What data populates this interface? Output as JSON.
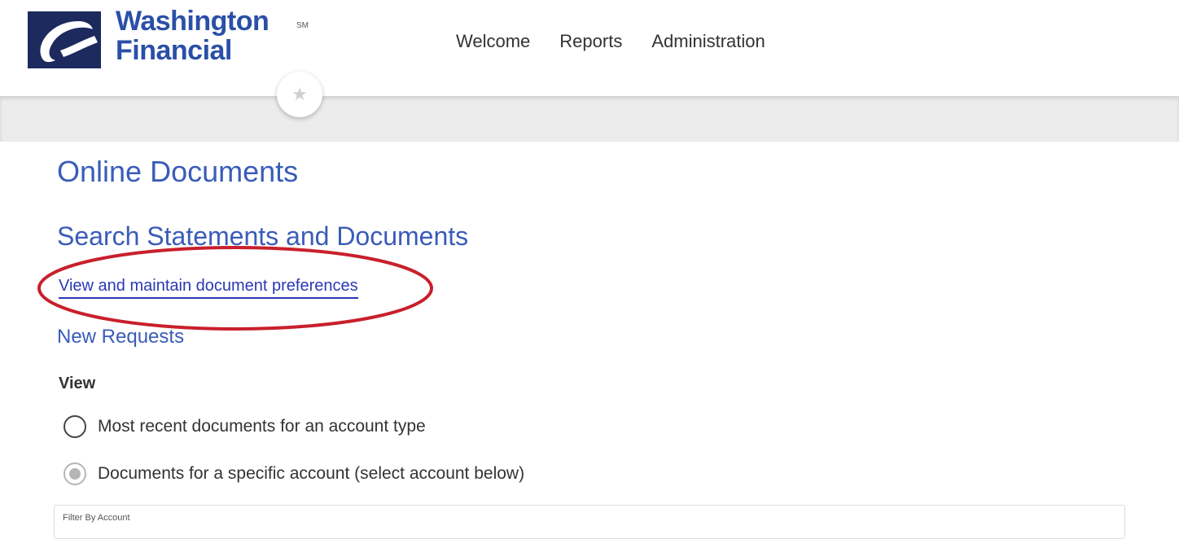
{
  "brand": {
    "name_line1": "Washington",
    "name_line2": "Financial",
    "service_mark": "SM",
    "primary_color": "#2a4fa8",
    "dark_color": "#1c2a5e"
  },
  "nav": {
    "items": [
      {
        "label": "Welcome"
      },
      {
        "label": "Reports"
      },
      {
        "label": "Administration"
      }
    ]
  },
  "favorites": {
    "icon": "star-icon"
  },
  "page": {
    "title": "Online Documents",
    "section_title": "Search Statements and Documents",
    "preferences_link": "View and maintain document preferences",
    "subsection_title": "New Requests",
    "view_label": "View",
    "annotation_color": "#c8202c"
  },
  "view_options": [
    {
      "label": "Most recent documents for an account type",
      "selected": false
    },
    {
      "label": "Documents for a specific account (select account below)",
      "selected": true
    }
  ],
  "filter": {
    "label": "Filter By Account"
  }
}
